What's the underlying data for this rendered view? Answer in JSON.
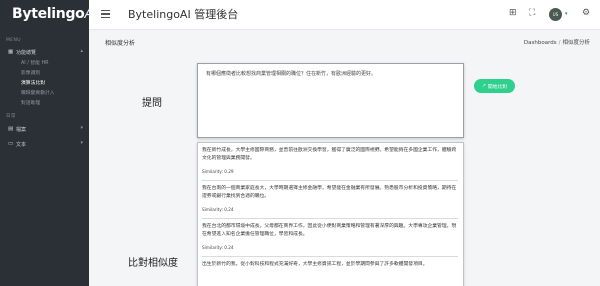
{
  "sidebar": {
    "logo_main": "Bytelingo",
    "logo_ai": "AI",
    "menu_label": "MENU",
    "sections": [
      {
        "label": "功能總覽",
        "items": [
          "AI / 智能 HR",
          "影像識別",
          "演算法比對",
          "職缺變異數計入",
          "對話助理"
        ]
      }
    ],
    "other_label": "日常",
    "other_items": [
      {
        "label": "檔案"
      },
      {
        "label": "文本"
      }
    ]
  },
  "topbar": {
    "title": "BytelingoAI 管理後台",
    "avatar_text": "US"
  },
  "page": {
    "title": "相似度分析",
    "breadcrumb": [
      "Dashboards",
      "相似度分析"
    ]
  },
  "question": {
    "label": "提問",
    "text": "有哪個應徵者比較想找商業管理相關的職位？住在新竹，有歐洲經驗的更好。",
    "button": "開始比對"
  },
  "results": {
    "label": "比對相似度",
    "similarity_prefix": "Similarity:",
    "items": [
      {
        "text": "我在新竹成長，大學主修國際商務，並曾前往歐洲交換學習，獲得了廣泛的國際視野。希望能夠在多國企業工作，體驗跨文化的管理與業務開發。",
        "score": "0.29"
      },
      {
        "text": "我在台南的一個商業家庭長大，大學時期選擇主修金融學，希望能在金融業有所發展。熟悉股市分析和投資策略，期待在證券或銀行業找到合適的職位。",
        "score": "0.24"
      },
      {
        "text": "我在台北的都市環境中成長，父母都在商界工作，因此從小便對商業策略和管理有著深厚的興趣。大學專攻企業管理，現在希望進入知名企業擔任管理職位，學習和成長。",
        "score": "0.24"
      },
      {
        "text": "出生於新竹的我，從小對科技和程式充滿好奇，大學主修資訊工程，並於學期間參與了許多軟體開發項目。",
        "score": ""
      }
    ]
  }
}
